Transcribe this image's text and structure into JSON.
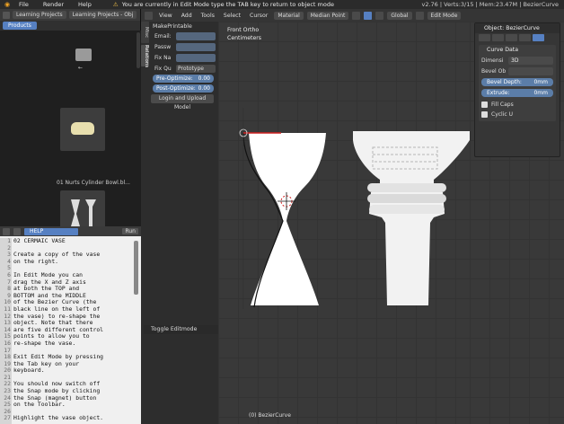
{
  "topbar": {
    "menus": [
      "File",
      "Render",
      "Help"
    ],
    "learning_tab": "Learning Projects",
    "learning_tab2": "Learning Projects - Obj",
    "status_message": "You are currently in Edit Mode type the TAB key to return to object mode",
    "stats": "v2.76 | Verts:3/15 | Mem:23.47M | BezierCurve"
  },
  "file_browser": {
    "products_tab": "Products",
    "folder_label": "←",
    "item1_label": "01 Nurts Cylinder Bowl.bl...",
    "tabs": [
      "Misc",
      "Relations"
    ]
  },
  "help": {
    "header_field": "HELP",
    "run_label": "Run",
    "line_numbers": "1\n2\n3\n4\n5\n6\n7\n8\n9\n10\n11\n12\n13\n14\n15\n16\n17\n18\n19\n20\n21\n22\n23\n24\n25\n26\n27",
    "lines": [
      "02 CERMAIC VASE",
      "",
      "Create a copy of the vase",
      "on the right.",
      "",
      "In Edit Mode you can",
      "drag the X and Z axis",
      "at both the TOP and",
      "BOTTOM and the MIDDLE",
      "of the Bezier Curve (the",
      "black line on the left of",
      "the vase) to re-shape the",
      "object. Note that there",
      "are five different control",
      "points to allow you to",
      "re-shape the vase.",
      "",
      "Exit Edit Mode by pressing",
      "the Tab key on your",
      "keyboard.",
      "",
      "You should now switch off",
      "the Snap mode by clicking",
      "the Snap (magnet) button",
      "on the Toolbar.",
      "",
      "Highlight the vase object."
    ]
  },
  "view_header": {
    "items": [
      "View",
      "Add",
      "Tools",
      "Select",
      "Cursor"
    ],
    "material": "Material",
    "pivot": "Median Point",
    "orientation": "Global",
    "mode": "Edit Mode"
  },
  "tool_shelf": {
    "panel_title": "MakePrintable",
    "email_label": "Email:",
    "password_label": "Passw",
    "fix_name_label": "Fix Na",
    "fix_quality_label": "Fix Qu",
    "fix_quality_value": "Prototype",
    "pre_optimize_label": "Pre-Optimize:",
    "pre_optimize_value": "0.00",
    "post_optimize_label": "Post-Optimize:",
    "post_optimize_value": "0.00",
    "login_button": "Login and Upload Model",
    "toggle_editmode": "Toggle Editmode"
  },
  "viewport": {
    "mode_label": "Front Ortho",
    "units_label": "Centimeters",
    "object_label": "(0) BezierCurve"
  },
  "properties": {
    "title": "Object: BezierCurve",
    "section_title": "Curve Data",
    "dimensions_label": "Dimensi",
    "dimensions_value": "3D",
    "bevel_object_label": "Bevel Ob",
    "bevel_depth_label": "Bevel Depth:",
    "bevel_depth_value": "0mm",
    "extrude_label": "Extrude:",
    "extrude_value": "0mm",
    "fill_caps_label": "Fill Caps",
    "cyclic_label": "Cyclic U"
  }
}
